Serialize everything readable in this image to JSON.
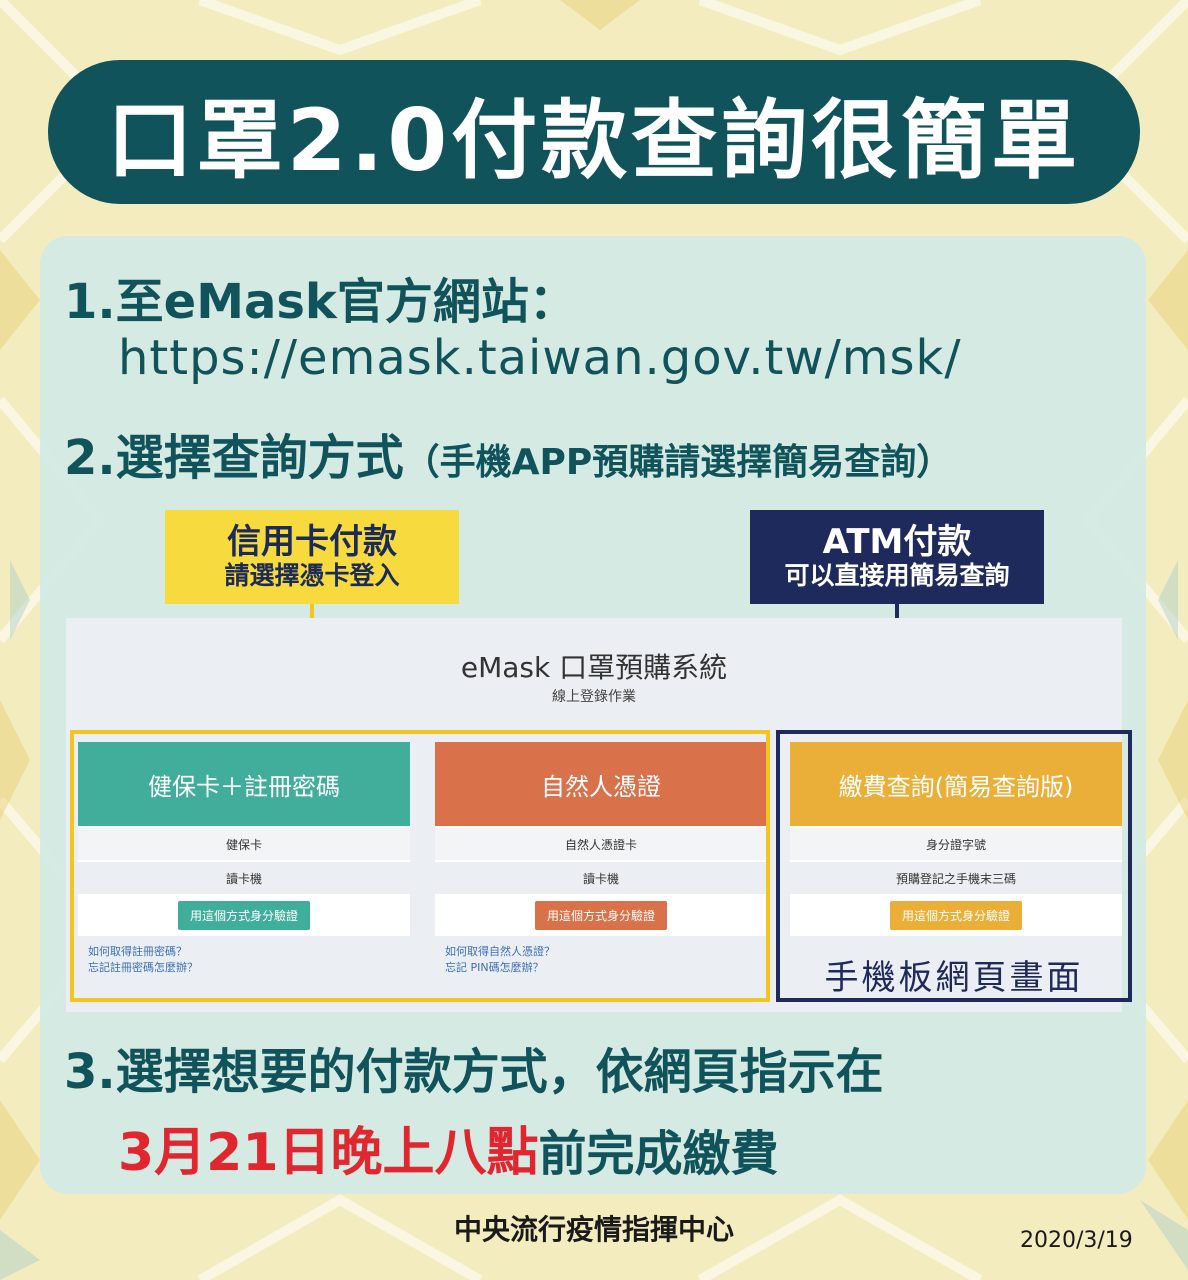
{
  "title": "口罩2.0付款查詢很簡單",
  "steps": {
    "step1": "1.至eMask官方網站：",
    "url": "https://emask.taiwan.gov.tw/msk/",
    "step2": "2.選擇查詢方式",
    "step2_note": "（手機APP預購請選擇簡易查詢）",
    "step3": "3.選擇想要的付款方式，依網頁指示在",
    "deadline_highlight": "3月21日晚上八點",
    "deadline_rest": "前完成繳費"
  },
  "labels": {
    "credit": {
      "main": "信用卡付款",
      "sub": "請選擇憑卡登入"
    },
    "atm": {
      "main": "ATM付款",
      "sub": "可以直接用簡易查詢"
    }
  },
  "screen": {
    "title": "eMask 口罩預購系統",
    "subtitle": "線上登錄作業",
    "cards": [
      {
        "header": "健保卡＋註冊密碼",
        "color": "#41ae9b",
        "row1": "健保卡",
        "row2": "讀卡機",
        "button": "用這個方式身分驗證",
        "link1": "如何取得註冊密碼？",
        "link2": "忘記註冊密碼怎麼辦？"
      },
      {
        "header": "自然人憑證",
        "color": "#d9714a",
        "row1": "自然人憑證卡",
        "row2": "讀卡機",
        "button": "用這個方式身分驗證",
        "link1": "如何取得自然人憑證？",
        "link2": "忘記 PIN碼怎麼辦？"
      },
      {
        "header": "繳費查詢(簡易查詢版)",
        "color": "#eaaf38",
        "row1": "身分證字號",
        "row2": "預購登記之手機末三碼",
        "button": "用這個方式身分驗證"
      }
    ],
    "mobile_note": "手機板網頁畫面"
  },
  "colors": {
    "title_bg": "#11535a",
    "highlight_red": "#e0262f",
    "credit_yellow": "#f2c51f",
    "atm_navy": "#1e2a5c"
  },
  "footer": {
    "org": "中央流行疫情指揮中心",
    "date": "2020/3/19"
  }
}
